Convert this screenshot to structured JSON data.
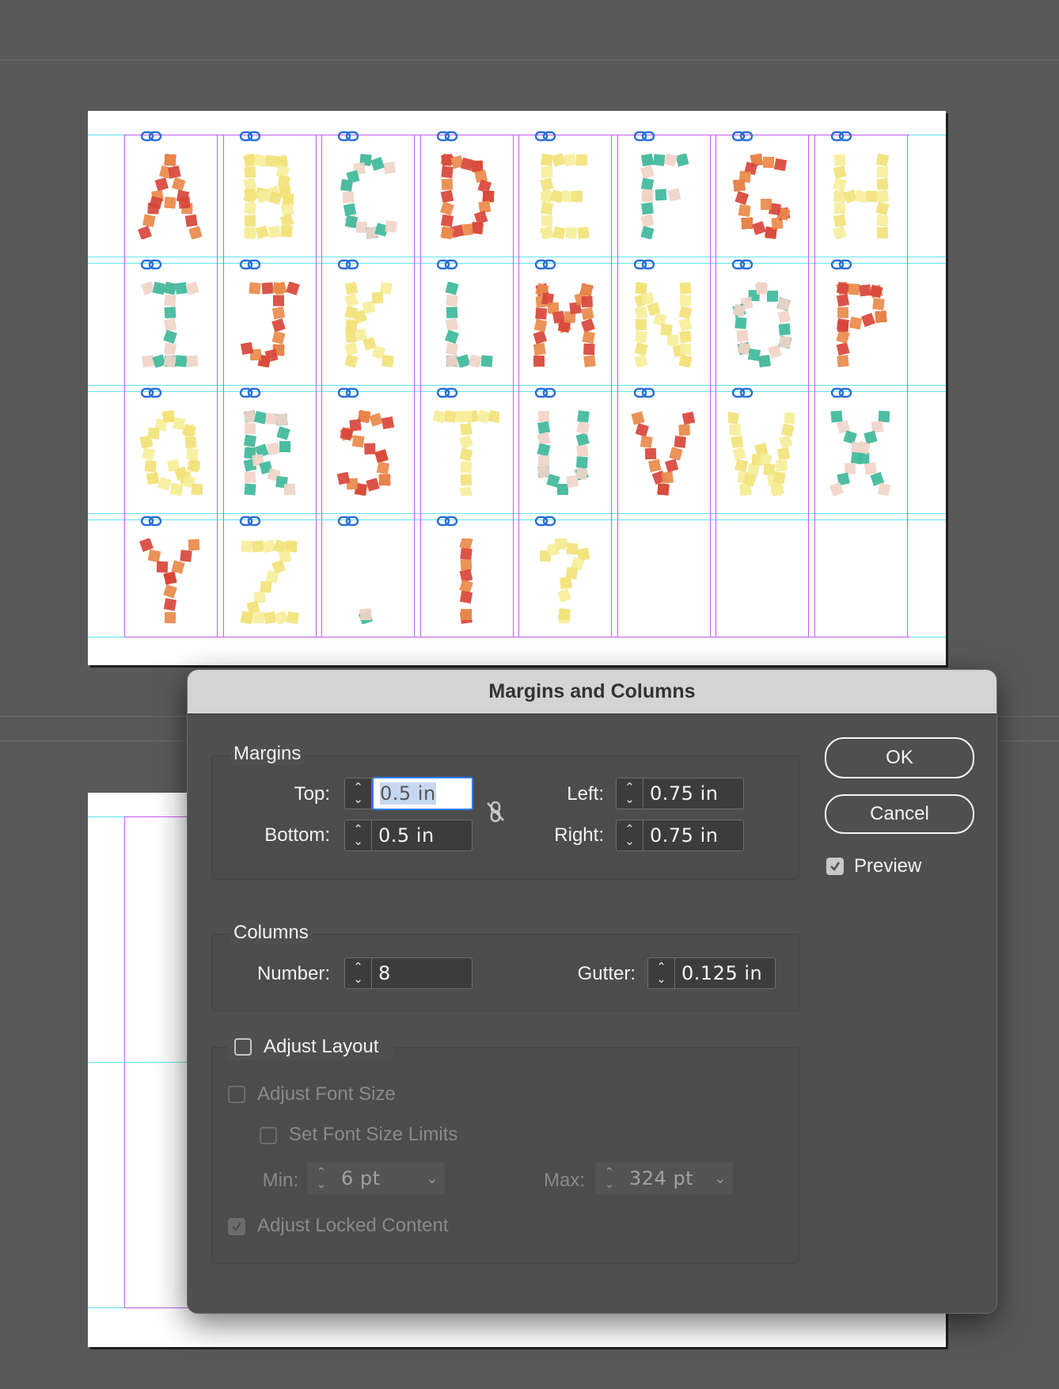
{
  "letters": [
    "A",
    "B",
    "C",
    "D",
    "E",
    "F",
    "G",
    "H",
    "I",
    "J",
    "K",
    "L",
    "M",
    "N",
    "O",
    "P",
    "Q",
    "R",
    "S",
    "T",
    "U",
    "V",
    "W",
    "X",
    "Y",
    "Z",
    ".",
    "!",
    "?"
  ],
  "palette": [
    "#d8453b",
    "#3fb89b",
    "#f2e27a",
    "#e98a4a",
    "#f1d4c8",
    "#f6ee9a"
  ],
  "dialog": {
    "title": "Margins and Columns",
    "margins": {
      "label": "Margins",
      "top_label": "Top:",
      "top_value": "0.5 in",
      "bottom_label": "Bottom:",
      "bottom_value": "0.5 in",
      "left_label": "Left:",
      "left_value": "0.75 in",
      "right_label": "Right:",
      "right_value": "0.75 in"
    },
    "columns": {
      "label": "Columns",
      "number_label": "Number:",
      "number_value": "8",
      "gutter_label": "Gutter:",
      "gutter_value": "0.125 in"
    },
    "adjust_layout": {
      "label": "Adjust Layout",
      "checked": false,
      "font_size_label": "Adjust Font Size",
      "font_size_checked": false,
      "limits_label": "Set Font Size Limits",
      "limits_checked": false,
      "min_label": "Min:",
      "min_value": "6 pt",
      "max_label": "Max:",
      "max_value": "324 pt",
      "locked_label": "Adjust Locked Content",
      "locked_checked": true
    },
    "buttons": {
      "ok": "OK",
      "cancel": "Cancel"
    },
    "preview": {
      "label": "Preview",
      "checked": true
    }
  }
}
